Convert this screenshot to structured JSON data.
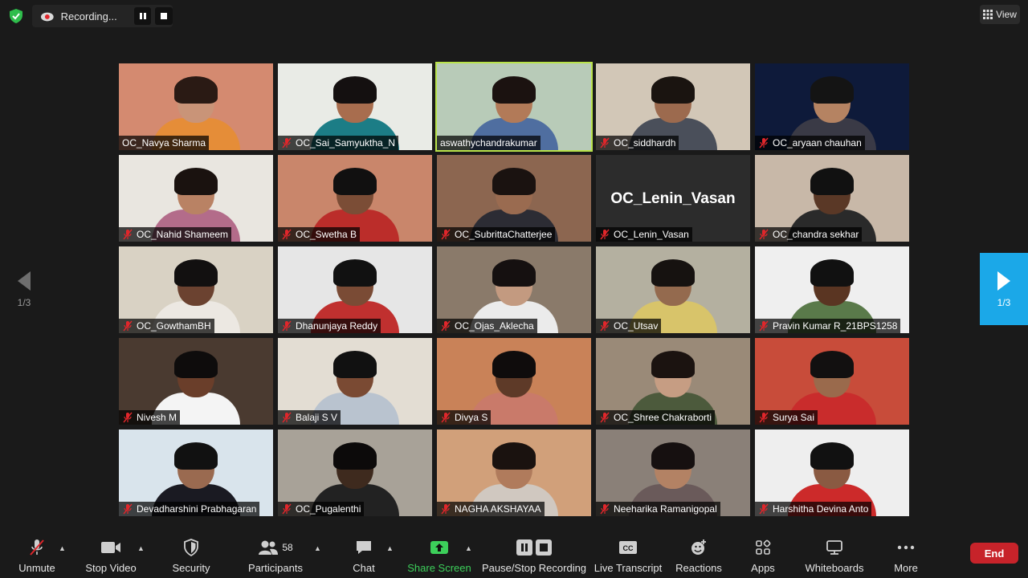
{
  "top": {
    "recording_label": "Recording...",
    "view_label": "View"
  },
  "grid": {
    "participants": [
      {
        "name": "OC_Navya Sharma",
        "muted": false,
        "active": false,
        "bg": "#d48a70",
        "skin": "#c99478",
        "hair": "#2a1a14",
        "shirt": "#e58d38"
      },
      {
        "name": "OC_Sai_Samyuktha_N",
        "muted": true,
        "active": false,
        "bg": "#e9ebe6",
        "skin": "#a86d4e",
        "hair": "#141010",
        "shirt": "#1c7d86"
      },
      {
        "name": "aswathychandrakumar",
        "muted": false,
        "active": true,
        "bg": "#b8cbb8",
        "skin": "#b27a58",
        "hair": "#1b1210",
        "shirt": "#4f6ea0"
      },
      {
        "name": "OC_siddhardh",
        "muted": true,
        "active": false,
        "bg": "#d2c7b7",
        "skin": "#9c6a4e",
        "hair": "#1a1410",
        "shirt": "#4a4f5a"
      },
      {
        "name": "OC_aryaan chauhan",
        "muted": true,
        "active": false,
        "bg": "#0e1a3a",
        "skin": "#b58362",
        "hair": "#141414",
        "shirt": "#3a3a46"
      },
      {
        "name": "OC_Nahid Shameem",
        "muted": true,
        "active": false,
        "bg": "#e9e6e0",
        "skin": "#b98264",
        "hair": "#1a120f",
        "shirt": "#b36c8a"
      },
      {
        "name": "OC_Swetha B",
        "muted": true,
        "active": false,
        "bg": "#c9866b",
        "skin": "#7b4d36",
        "hair": "#111010",
        "shirt": "#bb2d2a"
      },
      {
        "name": "OC_SubrittaChatterjee",
        "muted": true,
        "active": false,
        "bg": "#8c6650",
        "skin": "#9a6b50",
        "hair": "#1a1210",
        "shirt": "#2c2c34"
      },
      {
        "name": "OC_Lenin_Vasan",
        "muted": true,
        "active": false,
        "bg": "#2c2c2c",
        "skin": "",
        "hair": "",
        "shirt": ""
      },
      {
        "name": "OC_chandra sekhar",
        "muted": true,
        "active": false,
        "bg": "#c8b8a8",
        "skin": "#5a3826",
        "hair": "#111",
        "shirt": "#2a2a2a"
      },
      {
        "name": "OC_GowthamBH",
        "muted": true,
        "active": false,
        "bg": "#d9d2c4",
        "skin": "#6b4230",
        "hair": "#121010",
        "shirt": "#ece8e2"
      },
      {
        "name": "Dhanunjaya Reddy",
        "muted": true,
        "active": false,
        "bg": "#e6e6e6",
        "skin": "#7a4b35",
        "hair": "#111",
        "shirt": "#c0302f"
      },
      {
        "name": "OC_Ojas_Aklecha",
        "muted": true,
        "active": false,
        "bg": "#8a7a6a",
        "skin": "#c39a80",
        "hair": "#151010",
        "shirt": "#ebebeb"
      },
      {
        "name": "OC_Utsav",
        "muted": true,
        "active": false,
        "bg": "#b4b0a0",
        "skin": "#946a4e",
        "hair": "#161210",
        "shirt": "#d8c46a"
      },
      {
        "name": "Pravin Kumar R_21BPS1258",
        "muted": true,
        "active": false,
        "bg": "#efefef",
        "skin": "#5a3522",
        "hair": "#111",
        "shirt": "#5a7a4a"
      },
      {
        "name": "Nivesh M",
        "muted": true,
        "active": false,
        "bg": "#4a3a30",
        "skin": "#6a3e2a",
        "hair": "#0e0c0c",
        "shirt": "#f4f4f4"
      },
      {
        "name": "Balaji S V",
        "muted": true,
        "active": false,
        "bg": "#e3ddd3",
        "skin": "#7a4a33",
        "hair": "#111",
        "shirt": "#b9c3cf"
      },
      {
        "name": "Divya S",
        "muted": true,
        "active": false,
        "bg": "#c98258",
        "skin": "#5e3a28",
        "hair": "#0f0c0c",
        "shirt": "#c97a6a"
      },
      {
        "name": "OC_Shree Chakraborti",
        "muted": true,
        "active": false,
        "bg": "#9a8a78",
        "skin": "#c69d83",
        "hair": "#1b1310",
        "shirt": "#4c5a3c"
      },
      {
        "name": "Surya Sai",
        "muted": true,
        "active": false,
        "bg": "#c84c3a",
        "skin": "#9a6a4c",
        "hair": "#121010",
        "shirt": "#c92c2c"
      },
      {
        "name": "Devadharshini Prabhagaran",
        "muted": true,
        "active": false,
        "bg": "#d9e4ec",
        "skin": "#9a6a50",
        "hair": "#111",
        "shirt": "#1a1a22"
      },
      {
        "name": "OC_Pugalenthi",
        "muted": true,
        "active": false,
        "bg": "#a8a298",
        "skin": "#3e2a1e",
        "hair": "#0c0a0a",
        "shirt": "#222"
      },
      {
        "name": "NAGHA AKSHAYAA",
        "muted": true,
        "active": false,
        "bg": "#d1a07a",
        "skin": "#b07b5c",
        "hair": "#1a120f",
        "shirt": "#d0c8c0"
      },
      {
        "name": "Neeharika Ramanigopal",
        "muted": true,
        "active": false,
        "bg": "#8a8078",
        "skin": "#b38264",
        "hair": "#161010",
        "shirt": "#6a5a5a"
      },
      {
        "name": "Harshitha Devina Anto",
        "muted": true,
        "active": false,
        "bg": "#eeeeee",
        "skin": "#8a5a42",
        "hair": "#111",
        "shirt": "#cc2a2a"
      }
    ]
  },
  "pagination": {
    "left_page": "1/3",
    "right_page": "1/3"
  },
  "toolbar": {
    "unmute": "Unmute",
    "stop_video": "Stop Video",
    "security": "Security",
    "participants": "Participants",
    "participants_count": "58",
    "chat": "Chat",
    "share_screen": "Share Screen",
    "pause_stop_recording": "Pause/Stop Recording",
    "live_transcript": "Live Transcript",
    "reactions": "Reactions",
    "apps": "Apps",
    "whiteboards": "Whiteboards",
    "more": "More",
    "end": "End"
  },
  "colors": {
    "active_speaker": "#b9e34a",
    "share_green": "#3ccf5a",
    "end_red": "#c7232a",
    "page_arrow_blue": "#1ba8e8"
  }
}
